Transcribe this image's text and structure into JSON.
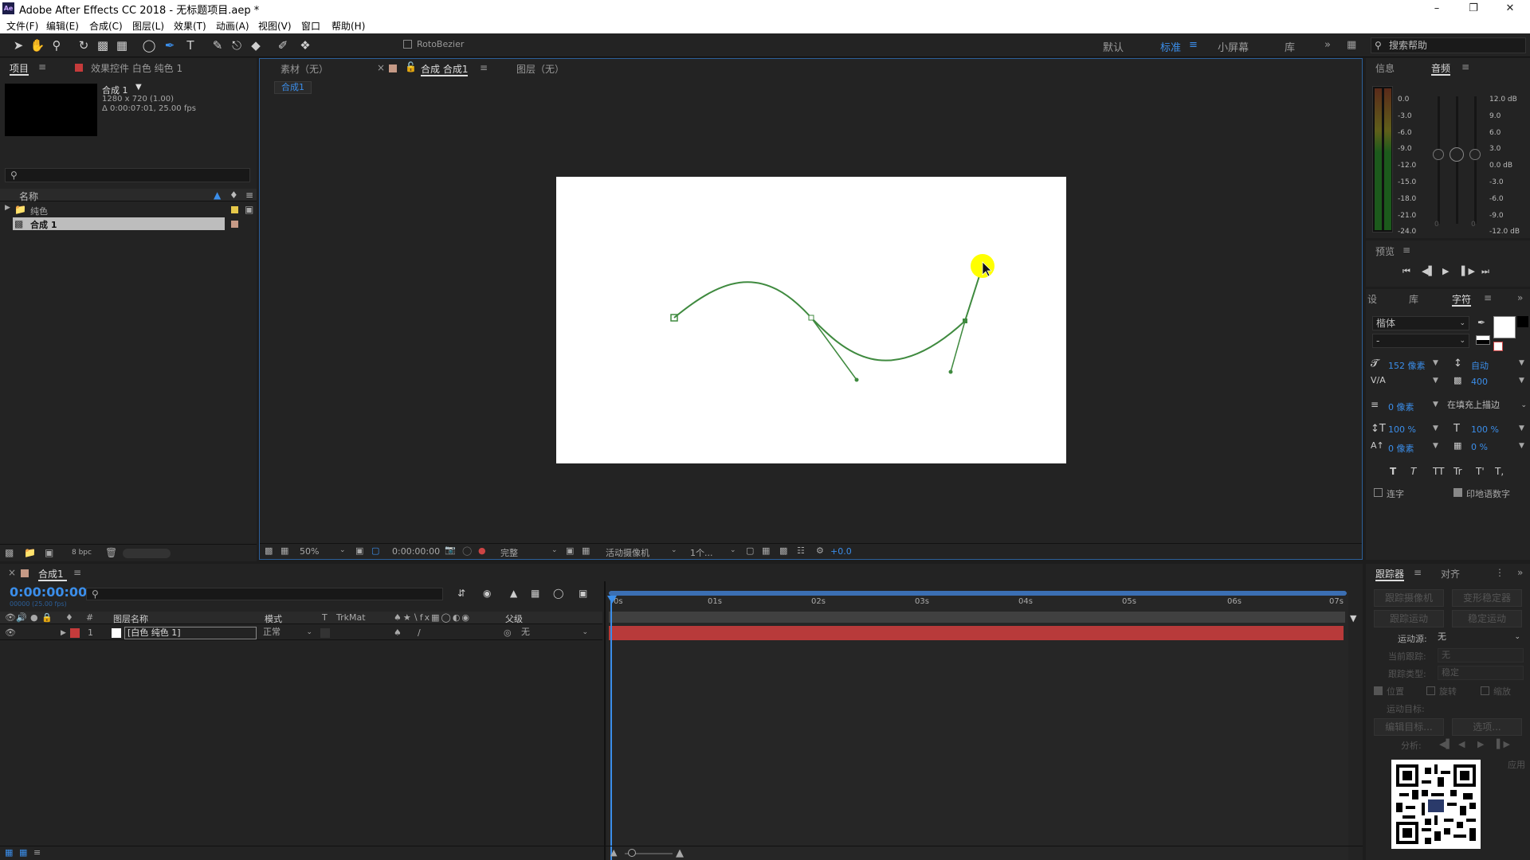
{
  "window": {
    "title": "Adobe After Effects CC 2018 - 无标题项目.aep *",
    "logo": "Ae"
  },
  "menu": [
    "文件(F)",
    "编辑(E)",
    "合成(C)",
    "图层(L)",
    "效果(T)",
    "动画(A)",
    "视图(V)",
    "窗口",
    "帮助(H)"
  ],
  "toolbar": {
    "rotobezier": "RotoBezier",
    "workspaces": [
      "默认",
      "标准",
      "小屏幕",
      "库"
    ],
    "active_workspace": "标准",
    "search_placeholder": "搜索帮助"
  },
  "project": {
    "tab": "项目",
    "effects_tab": "效果控件 白色 纯色 1",
    "comp_name": "合成 1",
    "comp_res": "1280 x 720 (1.00)",
    "comp_dur": "Δ 0:00:07:01, 25.00 fps",
    "col_name": "名称",
    "items": [
      {
        "name": "纯色",
        "type": "folder",
        "color": "#e6c84a"
      },
      {
        "name": "合成 1",
        "type": "comp",
        "color": "#c69a86",
        "selected": true
      }
    ],
    "bpc": "8 bpc"
  },
  "viewer": {
    "tabs": [
      "素材（无）",
      "合成 合成1",
      "图层（无）"
    ],
    "breadcrumb": "合成1",
    "zoom": "50%",
    "timecode": "0:00:00:00",
    "quality": "完整",
    "camera": "活动摄像机",
    "views": "1个...",
    "exposure": "+0.0"
  },
  "info": {
    "tab_info": "信息",
    "tab_audio": "音频",
    "scale_left": [
      "0.0",
      "-3.0",
      "-6.0",
      "-9.0",
      "-12.0",
      "-15.0",
      "-18.0",
      "-21.0",
      "-24.0"
    ],
    "scale_right": [
      "12.0 dB",
      "9.0",
      "6.0",
      "3.0",
      "0.0 dB",
      "-3.0",
      "-6.0",
      "-9.0",
      "-12.0 dB"
    ],
    "zero_marks": [
      "0",
      "0"
    ]
  },
  "preview": {
    "tab": "预览"
  },
  "character": {
    "tabs": [
      "设",
      "库",
      "字符"
    ],
    "font": "楷体",
    "style": "-",
    "size": "152 像素",
    "leading": "自动",
    "kerning_label": "V/A",
    "tracking": "400",
    "stroke": "0 像素",
    "stroke_mode": "在填充上描边",
    "vscale": "100 %",
    "hscale": "100 %",
    "baseline": "0 像素",
    "tsume": "0 %",
    "ligatures": "连字",
    "hindi": "印地语数字",
    "styles": [
      "T",
      "T",
      "TT",
      "Tr",
      "T'",
      "T,"
    ]
  },
  "timeline": {
    "tab": "合成1",
    "timecode": "0:00:00:00",
    "frames": "00000 (25.00 fps)",
    "cols": {
      "num": "#",
      "name": "图层名称",
      "mode": "模式",
      "t": "T",
      "trkmat": "TrkMat",
      "parent": "父级"
    },
    "ruler": [
      "0s",
      "01s",
      "02s",
      "03s",
      "04s",
      "05s",
      "06s",
      "07s"
    ],
    "layers": [
      {
        "num": "1",
        "name": "[白色 纯色 1]",
        "mode": "正常",
        "parent": "无",
        "label_color": "#c53b3b"
      }
    ]
  },
  "tracker": {
    "tabs": [
      "跟踪器",
      "对齐"
    ],
    "buttons": [
      "跟踪摄像机",
      "变形稳定器",
      "跟踪运动",
      "稳定运动"
    ],
    "motion_source_label": "运动源:",
    "motion_source": "无",
    "current_track_label": "当前跟踪:",
    "current_track": "无",
    "track_type_label": "跟踪类型:",
    "track_type": "稳定",
    "checks": [
      "位置",
      "旋转",
      "缩放"
    ],
    "motion_target": "运动目标:",
    "edit_target": "编辑目标...",
    "options": "选项...",
    "analyze": "分析:",
    "apply": "应用"
  },
  "colors": {
    "accent": "#3b8eea",
    "path": "#3f8a3f",
    "cursor": "#ffff00",
    "layer_bar": "#b83a3a"
  }
}
